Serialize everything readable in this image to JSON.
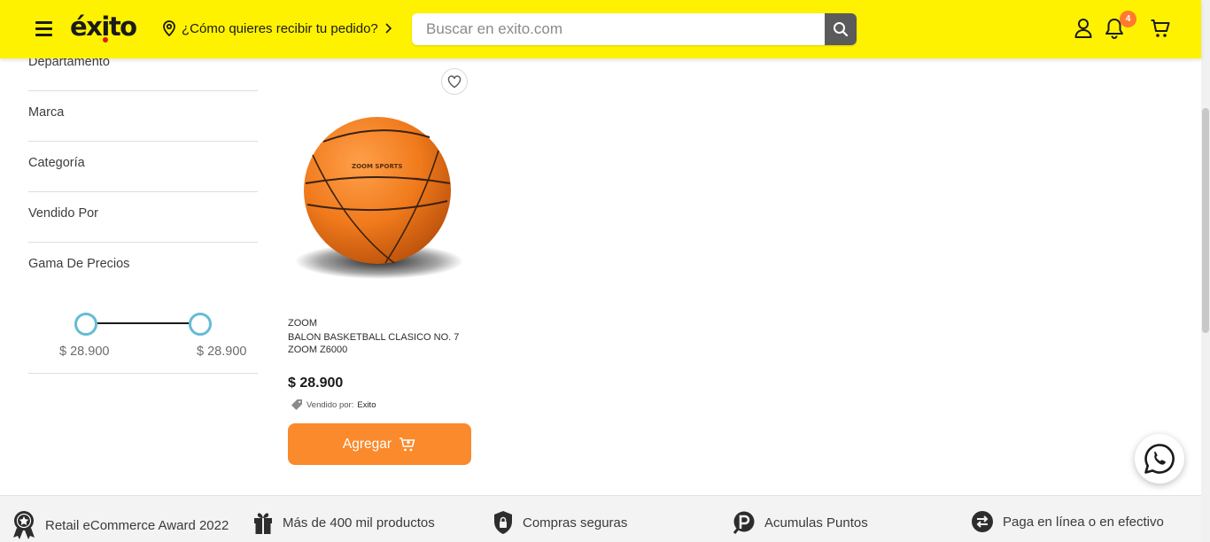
{
  "header": {
    "logo_text": "éxito",
    "location_prompt": "¿Cómo quieres recibir tu pedido?",
    "search_placeholder": "Buscar en exito.com",
    "notification_count": "4"
  },
  "filters": {
    "items": [
      {
        "label": "Departamento"
      },
      {
        "label": "Marca"
      },
      {
        "label": "Categoría"
      },
      {
        "label": "Vendido Por"
      },
      {
        "label": "Gama De Precios"
      }
    ],
    "price_range": {
      "min_label": "$ 28.900",
      "max_label": "$ 28.900"
    }
  },
  "product": {
    "brand": "ZOOM",
    "name": "BALON BASKETBALL CLASICO NO. 7 ZOOM Z6000",
    "price": "$ 28.900",
    "seller_prefix": "Vendido por:",
    "seller_name": "Exito",
    "add_button_label": "Agregar",
    "image_brand_text": "ZOOM SPORTS"
  },
  "footer": {
    "features": [
      {
        "label": "Retail eCommerce Award 2022",
        "icon": "award-medal-icon"
      },
      {
        "label": "Más de 400 mil productos",
        "icon": "gift-icon"
      },
      {
        "label": "Compras seguras",
        "icon": "shield-lock-icon"
      },
      {
        "label": "Acumulas Puntos",
        "icon": "points-icon"
      },
      {
        "label": "Paga en línea o en efectivo",
        "icon": "exchange-icon"
      }
    ]
  },
  "colors": {
    "brand_yellow": "#fff200",
    "cta_orange": "#fa8a2c",
    "slider_accent": "#64bcd3",
    "badge_orange": "#ff7a2c"
  }
}
